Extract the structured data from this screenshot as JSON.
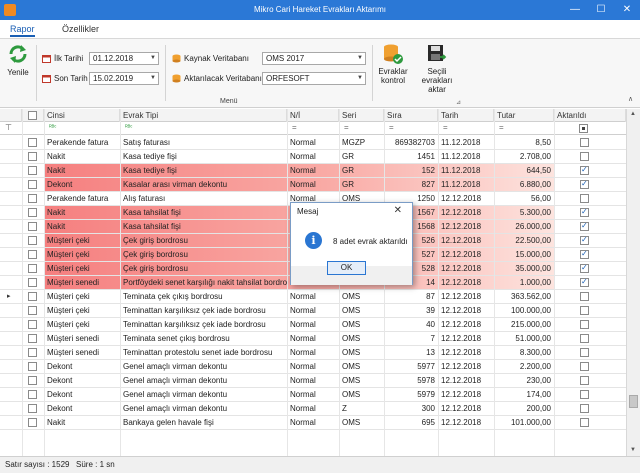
{
  "window": {
    "title": "Mikro Cari Hareket Evrakları Aktarımı",
    "minimize": "—",
    "maximize": "☐",
    "close": "✕"
  },
  "tabs": [
    {
      "label": "Rapor"
    },
    {
      "label": "Özellikler"
    }
  ],
  "ribbon": {
    "refresh_label": "Yenile",
    "first_date_label": "İlk Tarihi",
    "first_date_value": "01.12.2018",
    "last_date_label": "Son Tarih",
    "last_date_value": "15.02.2019",
    "source_db_label": "Kaynak Veritabanı",
    "source_db_value": "OMS 2017",
    "target_db_label": "Aktarılacak Veritabanı",
    "target_db_value": "ORFESOFT",
    "check_docs_label_1": "Evraklar",
    "check_docs_label_2": "kontrol",
    "transfer_label_1": "Seçili",
    "transfer_label_2": "evrakları aktar",
    "group_label": "Menü"
  },
  "grid": {
    "columns": [
      "Cinsi",
      "Evrak Tipi",
      "N/İ",
      "Seri",
      "Sıra",
      "Tarih",
      "Tutar",
      "Aktarıldı"
    ],
    "filter_symbols": [
      "ᴿᴮᶜ",
      "ᴿᴮᶜ",
      "=",
      "=",
      "=",
      "=",
      "="
    ],
    "rows": [
      {
        "cinsi": "Perakende fatura",
        "evrak_tipi": "Satış faturası",
        "ni": "Normal",
        "seri": "MGZP",
        "sira": "869382703",
        "tarih": "11.12.2018",
        "tutar": "8,50",
        "aktarildi": false,
        "highlight": false
      },
      {
        "cinsi": "Nakit",
        "evrak_tipi": "Kasa tediye fişi",
        "ni": "Normal",
        "seri": "GR",
        "sira": "1451",
        "tarih": "11.12.2018",
        "tutar": "2.708,00",
        "aktarildi": false,
        "highlight": false
      },
      {
        "cinsi": "Nakit",
        "evrak_tipi": "Kasa tediye fişi",
        "ni": "Normal",
        "seri": "GR",
        "sira": "152",
        "tarih": "11.12.2018",
        "tutar": "644,50",
        "aktarildi": true,
        "highlight": true
      },
      {
        "cinsi": "Dekont",
        "evrak_tipi": "Kasalar arası virman dekontu",
        "ni": "Normal",
        "seri": "GR",
        "sira": "827",
        "tarih": "11.12.2018",
        "tutar": "6.880,00",
        "aktarildi": true,
        "highlight": true
      },
      {
        "cinsi": "Perakende fatura",
        "evrak_tipi": "Alış faturası",
        "ni": "Normal",
        "seri": "OMS",
        "sira": "1250",
        "tarih": "12.12.2018",
        "tutar": "56,00",
        "aktarildi": false,
        "highlight": false
      },
      {
        "cinsi": "Nakit",
        "evrak_tipi": "Kasa tahsilat fişi",
        "ni": "Normal",
        "seri": "GR",
        "sira": "1567",
        "tarih": "12.12.2018",
        "tutar": "5.300,00",
        "aktarildi": true,
        "highlight": true
      },
      {
        "cinsi": "Nakit",
        "evrak_tipi": "Kasa tahsilat fişi",
        "ni": "Normal",
        "seri": "GR",
        "sira": "1568",
        "tarih": "12.12.2018",
        "tutar": "26.000,00",
        "aktarildi": true,
        "highlight": true
      },
      {
        "cinsi": "Müşteri çeki",
        "evrak_tipi": "Çek giriş bordrosu",
        "ni": "Normal",
        "seri": "GR",
        "sira": "526",
        "tarih": "12.12.2018",
        "tutar": "22.500,00",
        "aktarildi": true,
        "highlight": true
      },
      {
        "cinsi": "Müşteri çeki",
        "evrak_tipi": "Çek giriş bordrosu",
        "ni": "Normal",
        "seri": "GR",
        "sira": "527",
        "tarih": "12.12.2018",
        "tutar": "15.000,00",
        "aktarildi": true,
        "highlight": true
      },
      {
        "cinsi": "Müşteri çeki",
        "evrak_tipi": "Çek giriş bordrosu",
        "ni": "Normal",
        "seri": "GR",
        "sira": "528",
        "tarih": "12.12.2018",
        "tutar": "35.000,00",
        "aktarildi": true,
        "highlight": true
      },
      {
        "cinsi": "Müşteri senedi",
        "evrak_tipi": "Portföydeki senet karşılığı nakit tahsilat bordros",
        "ni": "Normal",
        "seri": "GR",
        "sira": "14",
        "tarih": "12.12.2018",
        "tutar": "1.000,00",
        "aktarildi": true,
        "highlight": true
      },
      {
        "cinsi": "Müşteri çeki",
        "evrak_tipi": "Teminata çek çıkış bordrosu",
        "ni": "Normal",
        "seri": "OMS",
        "sira": "87",
        "tarih": "12.12.2018",
        "tutar": "363.562,00",
        "aktarildi": false,
        "highlight": false
      },
      {
        "cinsi": "Müşteri çeki",
        "evrak_tipi": "Teminattan karşılıksız çek iade bordrosu",
        "ni": "Normal",
        "seri": "OMS",
        "sira": "39",
        "tarih": "12.12.2018",
        "tutar": "100.000,00",
        "aktarildi": false,
        "highlight": false
      },
      {
        "cinsi": "Müşteri çeki",
        "evrak_tipi": "Teminattan karşılıksız çek iade bordrosu",
        "ni": "Normal",
        "seri": "OMS",
        "sira": "40",
        "tarih": "12.12.2018",
        "tutar": "215.000,00",
        "aktarildi": false,
        "highlight": false
      },
      {
        "cinsi": "Müşteri senedi",
        "evrak_tipi": "Teminata senet çıkış bordrosu",
        "ni": "Normal",
        "seri": "OMS",
        "sira": "7",
        "tarih": "12.12.2018",
        "tutar": "51.000,00",
        "aktarildi": false,
        "highlight": false
      },
      {
        "cinsi": "Müşteri senedi",
        "evrak_tipi": "Teminattan protestolu senet iade bordrosu",
        "ni": "Normal",
        "seri": "OMS",
        "sira": "13",
        "tarih": "12.12.2018",
        "tutar": "8.300,00",
        "aktarildi": false,
        "highlight": false
      },
      {
        "cinsi": "Dekont",
        "evrak_tipi": "Genel amaçlı virman dekontu",
        "ni": "Normal",
        "seri": "OMS",
        "sira": "5977",
        "tarih": "12.12.2018",
        "tutar": "2.200,00",
        "aktarildi": false,
        "highlight": false
      },
      {
        "cinsi": "Dekont",
        "evrak_tipi": "Genel amaçlı virman dekontu",
        "ni": "Normal",
        "seri": "OMS",
        "sira": "5978",
        "tarih": "12.12.2018",
        "tutar": "230,00",
        "aktarildi": false,
        "highlight": false
      },
      {
        "cinsi": "Dekont",
        "evrak_tipi": "Genel amaçlı virman dekontu",
        "ni": "Normal",
        "seri": "OMS",
        "sira": "5979",
        "tarih": "12.12.2018",
        "tutar": "174,00",
        "aktarildi": false,
        "highlight": false
      },
      {
        "cinsi": "Dekont",
        "evrak_tipi": "Genel amaçlı virman dekontu",
        "ni": "Normal",
        "seri": "Z",
        "sira": "300",
        "tarih": "12.12.2018",
        "tutar": "200,00",
        "aktarildi": false,
        "highlight": false
      },
      {
        "cinsi": "Nakit",
        "evrak_tipi": "Bankaya gelen havale fişi",
        "ni": "Normal",
        "seri": "OMS",
        "sira": "695",
        "tarih": "12.12.2018",
        "tutar": "101.000,00",
        "aktarildi": false,
        "highlight": false
      }
    ]
  },
  "dialog": {
    "title": "Mesaj",
    "message": "8 adet evrak aktarıldı",
    "ok_label": "OK",
    "icon": "i"
  },
  "status": {
    "row_count": "Satır sayısı : 1529",
    "duration": "Süre : 1 sn"
  },
  "colors": {
    "titlebar": "#2b78d6",
    "highlight": "#f57f7f",
    "accent": "#1a5fb4"
  }
}
